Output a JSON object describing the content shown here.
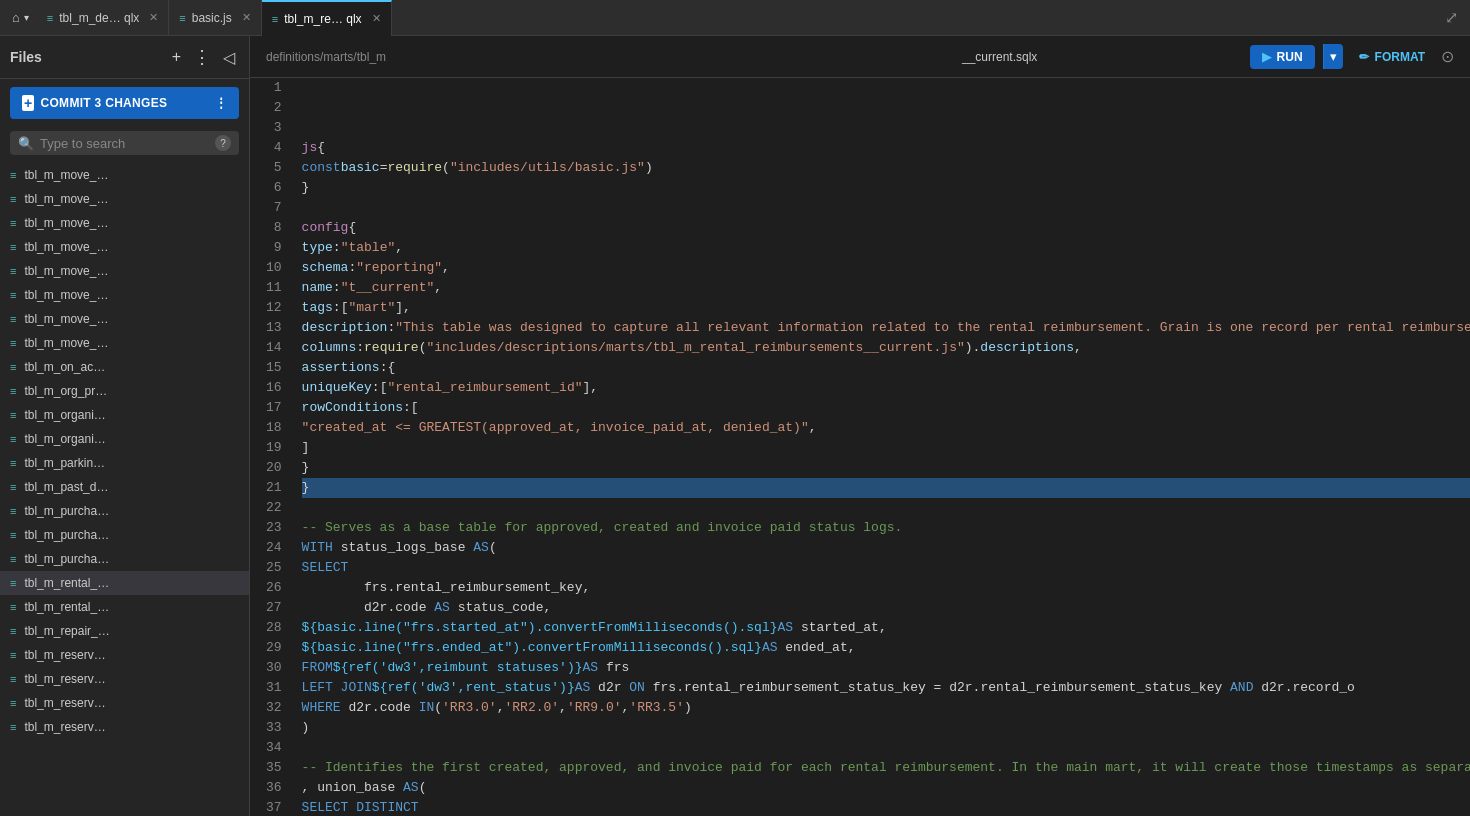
{
  "tabs": {
    "home": {
      "label": "⌂"
    },
    "items": [
      {
        "id": "tab-tbl-m-de",
        "label": "tbl_m_de… qlx",
        "icon": "≡",
        "active": false
      },
      {
        "id": "tab-basic-js",
        "label": "basic.js",
        "icon": "≡",
        "active": false
      },
      {
        "id": "tab-tbl-m-re",
        "label": "tbl_m_re… qlx",
        "icon": "≡",
        "active": true
      }
    ],
    "action_icon": "⤢"
  },
  "sidebar": {
    "title": "Files",
    "commit_label": "COMMIT 3 CHANGES",
    "search_placeholder": "Type to search",
    "files": [
      {
        "name": "tbl_m_move_…",
        "active": false
      },
      {
        "name": "tbl_m_move_…",
        "active": false
      },
      {
        "name": "tbl_m_move_…",
        "active": false
      },
      {
        "name": "tbl_m_move_…",
        "active": false
      },
      {
        "name": "tbl_m_move_…",
        "active": false
      },
      {
        "name": "tbl_m_move_…",
        "active": false
      },
      {
        "name": "tbl_m_move_…",
        "active": false
      },
      {
        "name": "tbl_m_move_…",
        "active": false
      },
      {
        "name": "tbl_m_on_ac…",
        "active": false
      },
      {
        "name": "tbl_m_org_pr…",
        "active": false
      },
      {
        "name": "tbl_m_organi…",
        "active": false
      },
      {
        "name": "tbl_m_organi…",
        "active": false
      },
      {
        "name": "tbl_m_parkin…",
        "active": false
      },
      {
        "name": "tbl_m_past_d…",
        "active": false
      },
      {
        "name": "tbl_m_purcha…",
        "active": false
      },
      {
        "name": "tbl_m_purcha…",
        "active": false
      },
      {
        "name": "tbl_m_purcha…",
        "active": false
      },
      {
        "name": "tbl_m_rental_…",
        "active": true
      },
      {
        "name": "tbl_m_rental_…",
        "active": false
      },
      {
        "name": "tbl_m_repair_…",
        "active": false
      },
      {
        "name": "tbl_m_reserv…",
        "active": false
      },
      {
        "name": "tbl_m_reserv…",
        "active": false
      },
      {
        "name": "tbl_m_reserv…",
        "active": false
      },
      {
        "name": "tbl_m_reserv…",
        "active": false
      }
    ]
  },
  "editor": {
    "breadcrumb": "definitions/marts/tbl_m",
    "filename": "__current.sqlx",
    "run_label": "RUN",
    "format_label": "FORMAT"
  }
}
